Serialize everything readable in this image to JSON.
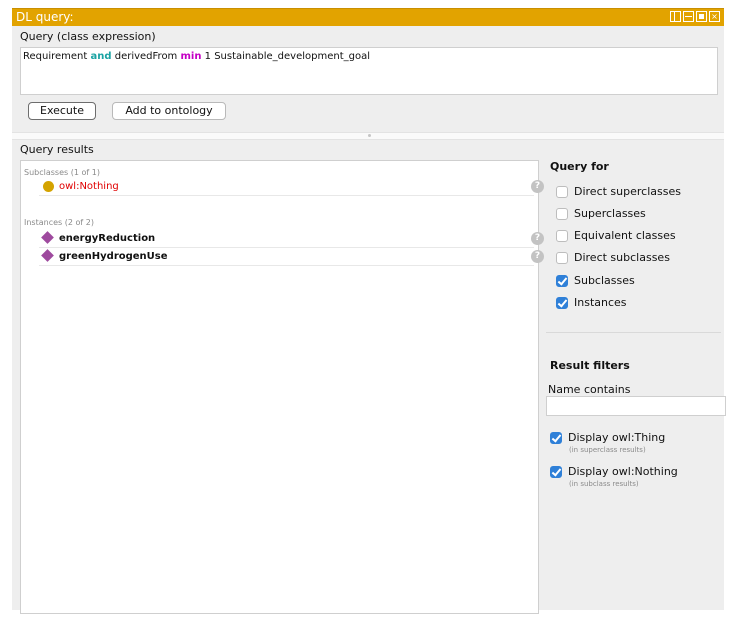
{
  "window": {
    "title": "DL query:"
  },
  "query": {
    "section_label": "Query (class expression)",
    "expression": {
      "part1": "Requirement",
      "kw_and": "and",
      "part2": "derivedFrom",
      "kw_min": "min",
      "part3": "1 Sustainable_development_goal"
    },
    "execute_label": "Execute",
    "add_label": "Add to ontology"
  },
  "results": {
    "section_label": "Query results",
    "subclasses_label": "Subclasses (1 of 1)",
    "subclasses": [
      {
        "label": "owl:Nothing"
      }
    ],
    "instances_label": "Instances (2 of 2)",
    "instances": [
      {
        "label": "energyReduction"
      },
      {
        "label": "greenHydrogenUse"
      }
    ],
    "help_glyph": "?"
  },
  "query_for": {
    "heading": "Query for",
    "options": [
      {
        "label": "Direct superclasses",
        "checked": false
      },
      {
        "label": "Superclasses",
        "checked": false
      },
      {
        "label": "Equivalent classes",
        "checked": false
      },
      {
        "label": "Direct subclasses",
        "checked": false
      },
      {
        "label": "Subclasses",
        "checked": true
      },
      {
        "label": "Instances",
        "checked": true
      }
    ]
  },
  "filters": {
    "heading": "Result filters",
    "name_contains_label": "Name contains",
    "name_contains_value": "",
    "display_thing_label": "Display owl:Thing",
    "display_thing_note": "(in superclass results)",
    "display_thing_checked": true,
    "display_nothing_label": "Display owl:Nothing",
    "display_nothing_note": "(in subclass results)",
    "display_nothing_checked": true
  },
  "colors": {
    "titlebar": "#e2a300",
    "keyword_and": "#1aa3a3",
    "keyword_min": "#c400c4",
    "nothing_red": "#e00000",
    "class_icon": "#d4a300",
    "individual_icon": "#9e4a9e",
    "checkbox_on": "#2f80d8"
  }
}
